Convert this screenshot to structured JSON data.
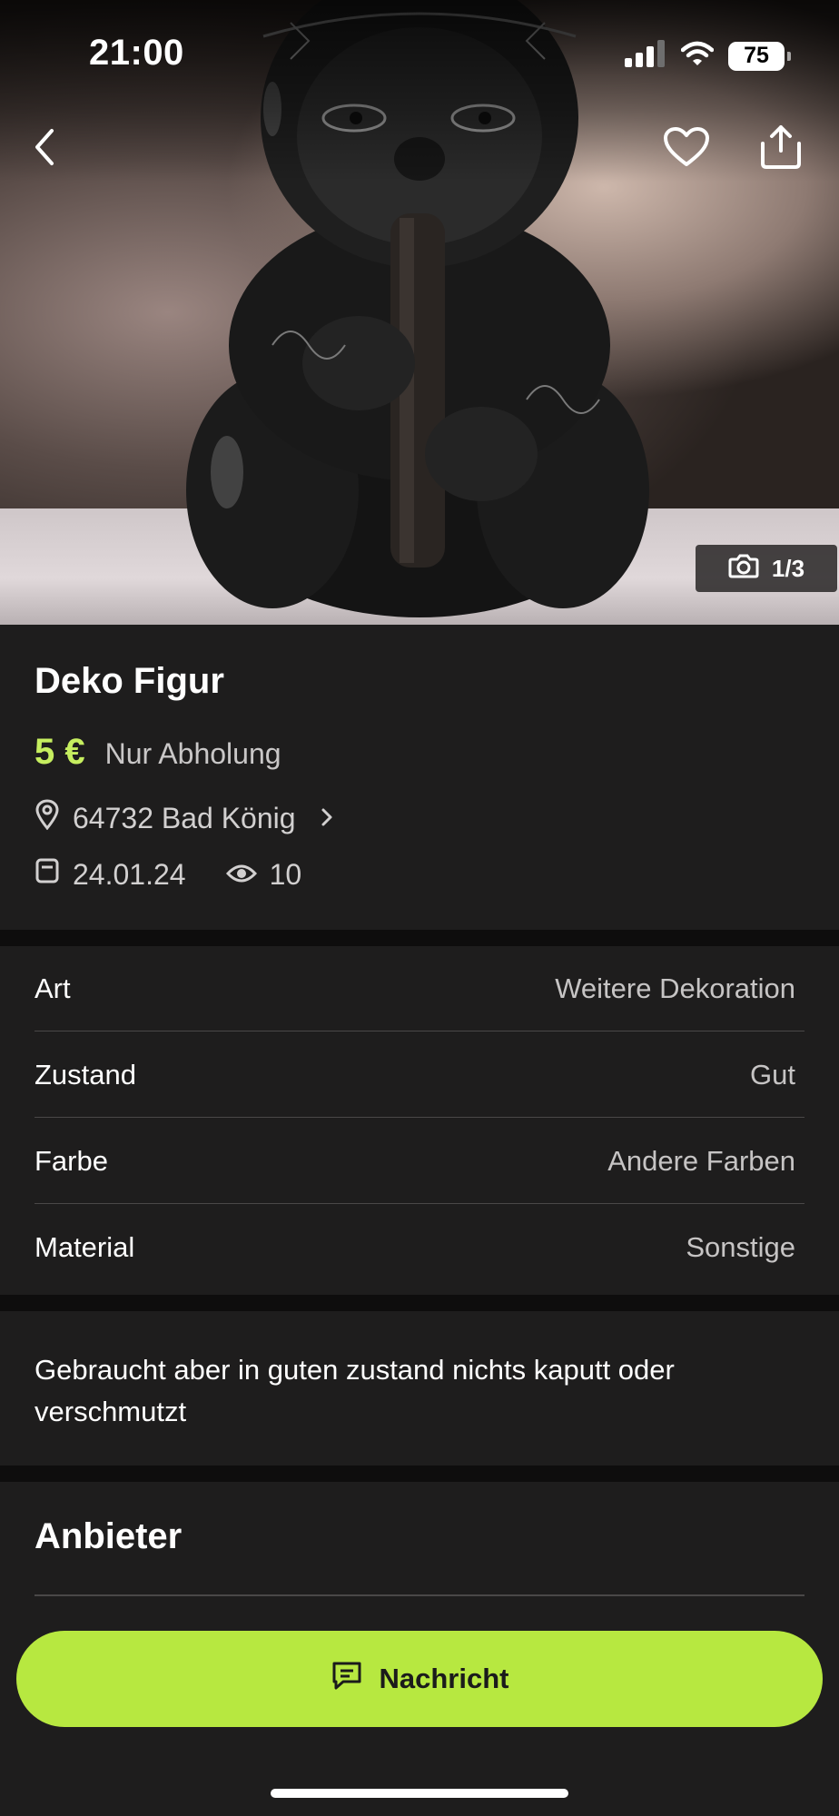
{
  "status_bar": {
    "time": "21:00",
    "battery": "75",
    "icons": [
      "signal-icon",
      "wifi-icon",
      "battery-icon"
    ]
  },
  "header": {
    "icons": [
      "back-icon",
      "heart-icon",
      "share-icon"
    ]
  },
  "gallery": {
    "counter": "1/3",
    "icon": "camera-icon"
  },
  "listing": {
    "title": "Deko Figur",
    "price": "5 €",
    "delivery": "Nur Abholung",
    "location": "64732 Bad König",
    "date": "24.01.24",
    "views": "10"
  },
  "attributes": [
    {
      "label": "Art",
      "value": "Weitere Dekoration"
    },
    {
      "label": "Zustand",
      "value": "Gut"
    },
    {
      "label": "Farbe",
      "value": "Andere Farben"
    },
    {
      "label": "Material",
      "value": "Sonstige"
    }
  ],
  "description": "Gebraucht aber in guten zustand nichts kaputt oder verschmutzt",
  "seller": {
    "title": "Anbieter"
  },
  "cta": {
    "label": "Nachricht",
    "icon": "message-icon"
  },
  "colors": {
    "background": "#1e1d1d",
    "accent": "#b7e840",
    "price": "#c6ee5f",
    "separator": "#0e0d0d"
  }
}
